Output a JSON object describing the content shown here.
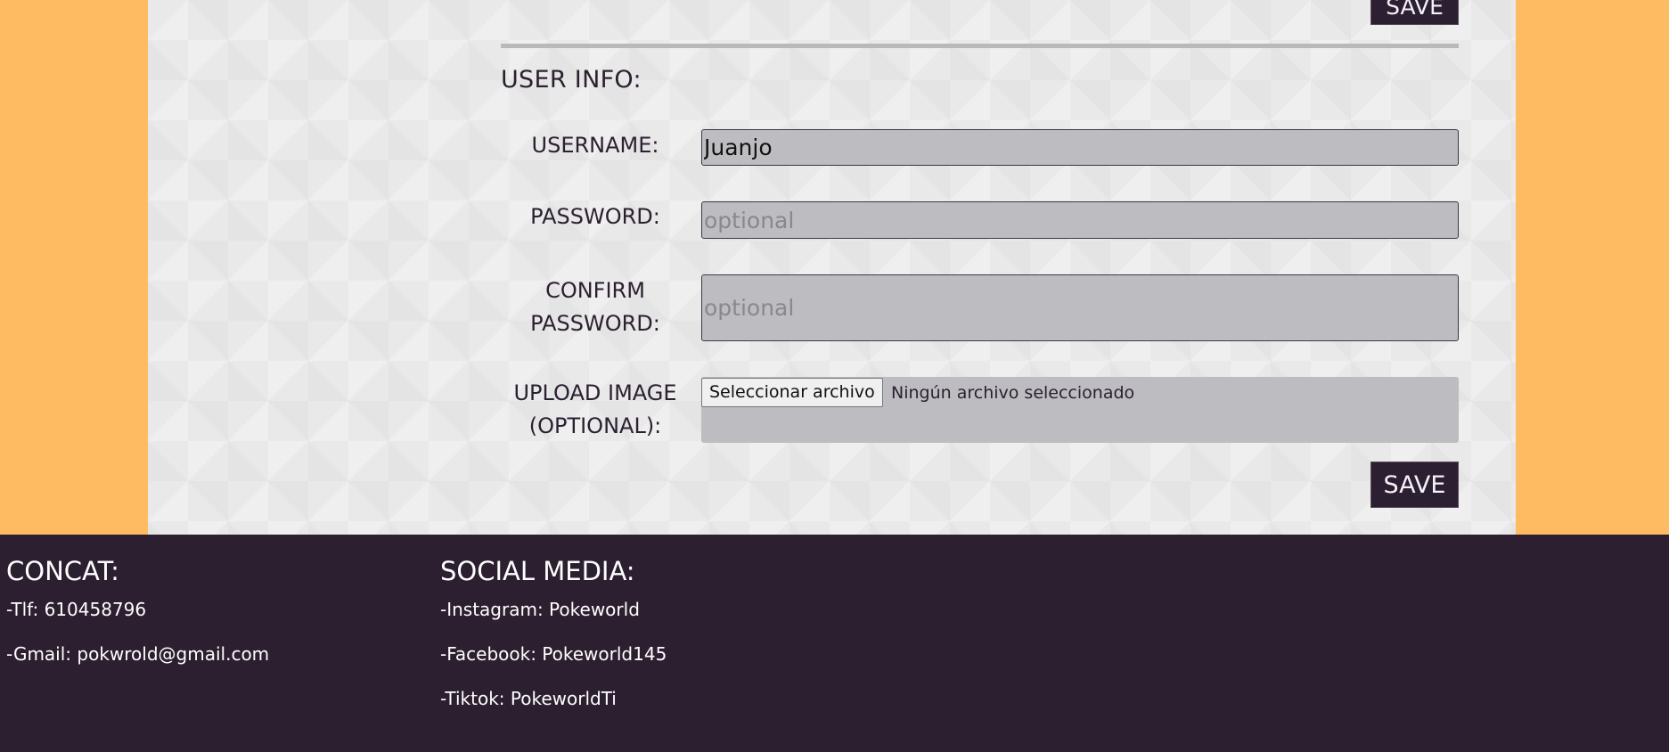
{
  "form": {
    "top_save_label": "SAVE",
    "section_title": "USER INFO:",
    "username_label": "USERNAME:",
    "username_value": "Juanjo",
    "password_label": "PASSWORD:",
    "password_placeholder": "optional",
    "confirm_label": "CONFIRM PASSWORD:",
    "confirm_placeholder": "optional",
    "upload_label": "UPLOAD IMAGE (OPTIONAL):",
    "file_button_label": "Seleccionar archivo",
    "file_status": "Ningún archivo seleccionado",
    "save_label": "SAVE"
  },
  "footer": {
    "contact": {
      "heading": "CONCAT:",
      "items": [
        "-Tlf: 610458796",
        "-Gmail: pokwrold@gmail.com"
      ]
    },
    "social": {
      "heading": "SOCIAL MEDIA:",
      "items": [
        "-Instagram: Pokeworld",
        "-Facebook: Pokeworld145",
        "-Tiktok: PokeworldTi"
      ]
    }
  },
  "colors": {
    "page_background": "#ffbb62",
    "panel_background": "#e9e9e9",
    "input_background": "#bdbcc1",
    "button_background": "#2d1f32",
    "footer_background": "#2c1f30",
    "text_dark": "#2c1f30",
    "text_light": "#ffffff"
  }
}
